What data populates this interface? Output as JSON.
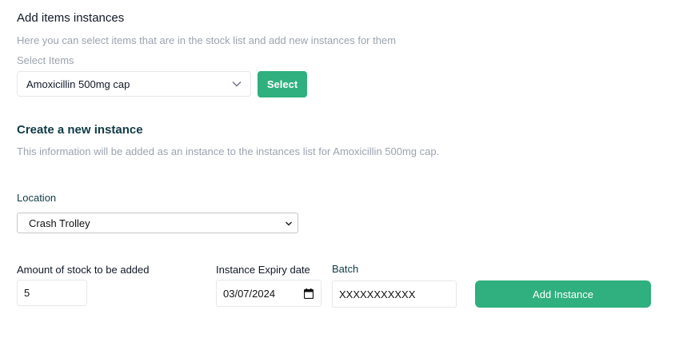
{
  "header": {
    "title": "Add items instances",
    "description": "Here you can select items that are in the stock list and add new instances for them"
  },
  "item_picker": {
    "label": "Select Items",
    "selected": "Amoxicillin 500mg cap",
    "button_label": "Select"
  },
  "new_instance": {
    "title": "Create a new instance",
    "description": "This information will be added as an instance to the instances list for Amoxicillin 500mg cap."
  },
  "location": {
    "label": "Location",
    "selected": "Crash Trolley"
  },
  "amount": {
    "label": "Amount of stock to be added",
    "value": "5"
  },
  "expiry": {
    "label": "Instance Expiry date",
    "value": "03/07/2024"
  },
  "batch": {
    "label": "Batch",
    "value": "XXXXXXXXXXX"
  },
  "actions": {
    "add_label": "Add Instance"
  },
  "colors": {
    "accent": "#2fb07e",
    "heading": "#0f3b46",
    "muted": "#9ca3af"
  }
}
